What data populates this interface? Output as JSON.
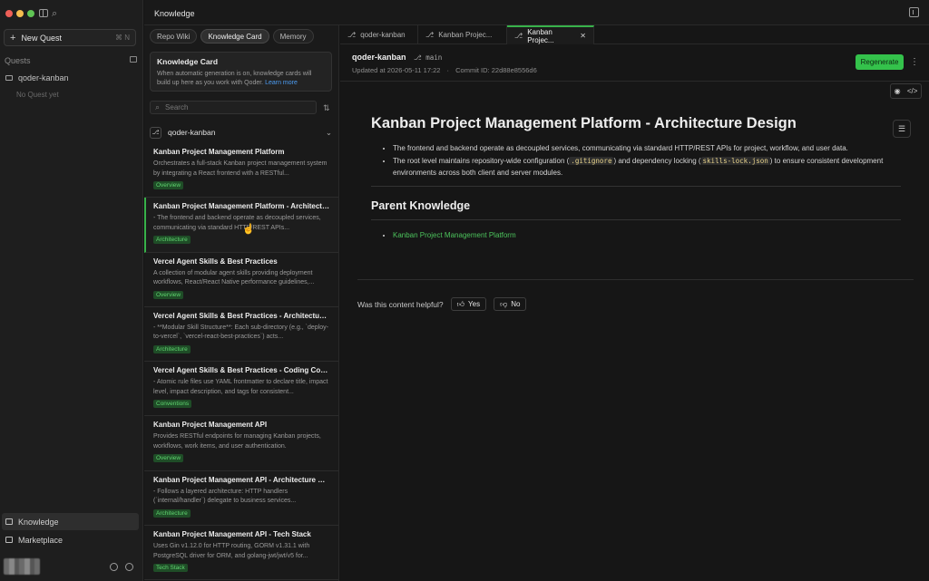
{
  "sidebar": {
    "new_quest_label": "New Quest",
    "new_quest_shortcut": "⌘ N",
    "quests_heading": "Quests",
    "quest_items": [
      "qoder-kanban"
    ],
    "no_quest_text": "No Quest yet",
    "nav": {
      "knowledge": "Knowledge",
      "marketplace": "Marketplace"
    }
  },
  "titlebar": {
    "title": "Knowledge"
  },
  "middle": {
    "tabs": [
      "Repo Wiki",
      "Knowledge Card",
      "Memory"
    ],
    "active_tab": "Knowledge Card",
    "kc_box": {
      "heading": "Knowledge Card",
      "body": "When automatic generation is on, knowledge cards will build up here as you work with Qoder.",
      "link": "Learn more"
    },
    "search_placeholder": "Search",
    "repo_name": "qoder-kanban",
    "cards": [
      {
        "title": "Kanban Project Management Platform",
        "desc": "Orchestrates a full-stack Kanban project management system by integrating a React frontend with a RESTful...",
        "tag": "Overview"
      },
      {
        "title": "Kanban Project Management Platform - Architectur...",
        "desc": "- The frontend and backend operate as decoupled services, communicating via standard HTTP/REST APIs...",
        "tag": "Architecture"
      },
      {
        "title": "Vercel Agent Skills & Best Practices",
        "desc": "A collection of modular agent skills providing deployment workflows, React/React Native performance guidelines,...",
        "tag": "Overview"
      },
      {
        "title": "Vercel Agent Skills & Best Practices - Architecture ...",
        "desc": "- **Modular Skill Structure**: Each sub-directory (e.g., `deploy-to-vercel`, `vercel-react-best-practices`) acts...",
        "tag": "Architecture"
      },
      {
        "title": "Vercel Agent Skills & Best Practices - Coding Conv...",
        "desc": "- Atomic rule files use YAML frontmatter to declare title, impact level, impact description, and tags for consistent...",
        "tag": "Conventions"
      },
      {
        "title": "Kanban Project Management API",
        "desc": "Provides RESTful endpoints for managing Kanban projects, workflows, work items, and user authentication.",
        "tag": "Overview"
      },
      {
        "title": "Kanban Project Management API - Architecture De...",
        "desc": "- Follows a layered architecture: HTTP handlers (`internal/handler`) delegate to business services...",
        "tag": "Architecture"
      },
      {
        "title": "Kanban Project Management API - Tech Stack",
        "desc": "Uses Gin v1.12.0 for HTTP routing, GORM v1.31.1 with PostgreSQL driver for ORM, and golang-jwt/jwt/v5 for...",
        "tag": "Tech Stack"
      }
    ]
  },
  "content": {
    "tabs": [
      "qoder-kanban",
      "Kanban Projec...",
      "Kanban Projec..."
    ],
    "repo": "qoder-kanban",
    "branch": "main",
    "updated": "Updated at 2026-05-11 17:22",
    "commit": "Commit ID: 22d88e8556d6",
    "regenerate_label": "Regenerate",
    "doc": {
      "title": "Kanban Project Management Platform - Architecture Design",
      "bullet1": "The frontend and backend operate as decoupled services, communicating via standard HTTP/REST APIs for project, workflow, and user data.",
      "bullet2_a": "The root level maintains repository-wide configuration (",
      "bullet2_code1": ".gitignore",
      "bullet2_b": ") and dependency locking (",
      "bullet2_code2": "skills-lock.json",
      "bullet2_c": ") to ensure consistent development environments across both client and server modules.",
      "parent_heading": "Parent Knowledge",
      "parent_link": "Kanban Project Management Platform"
    },
    "feedback": {
      "question": "Was this content helpful?",
      "yes": "Yes",
      "no": "No"
    }
  },
  "colors": {
    "accent_green": "#34c24b",
    "tag_bg": "#1f4d27",
    "tag_text": "#5fd36f"
  }
}
